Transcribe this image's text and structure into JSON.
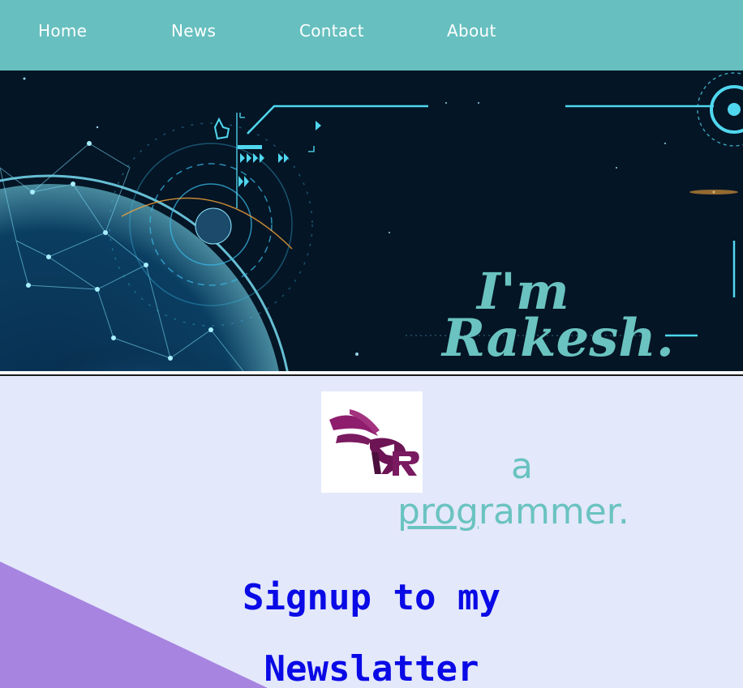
{
  "nav": {
    "items": [
      {
        "label": "Home"
      },
      {
        "label": "News"
      },
      {
        "label": "Contact"
      },
      {
        "label": "About"
      }
    ]
  },
  "hero": {
    "line1": "I'm",
    "line2": "Rakesh."
  },
  "tagline": {
    "word_a": "a",
    "word_prog_underlined": "prog",
    "word_prog_rest": "rammer."
  },
  "logo": {
    "letter": "R"
  },
  "newsletter": {
    "line1": "Signup to my",
    "line2": "Newslatter"
  },
  "colors": {
    "nav_bg": "#67bfbf",
    "hero_bg": "#041525",
    "accent_teal": "#6ac3c0",
    "page_bg": "#e3e8fb",
    "purple_shape": "#a784e0",
    "signup_blue": "#0a0ae6",
    "logo_magenta": "#8e1d6e"
  }
}
